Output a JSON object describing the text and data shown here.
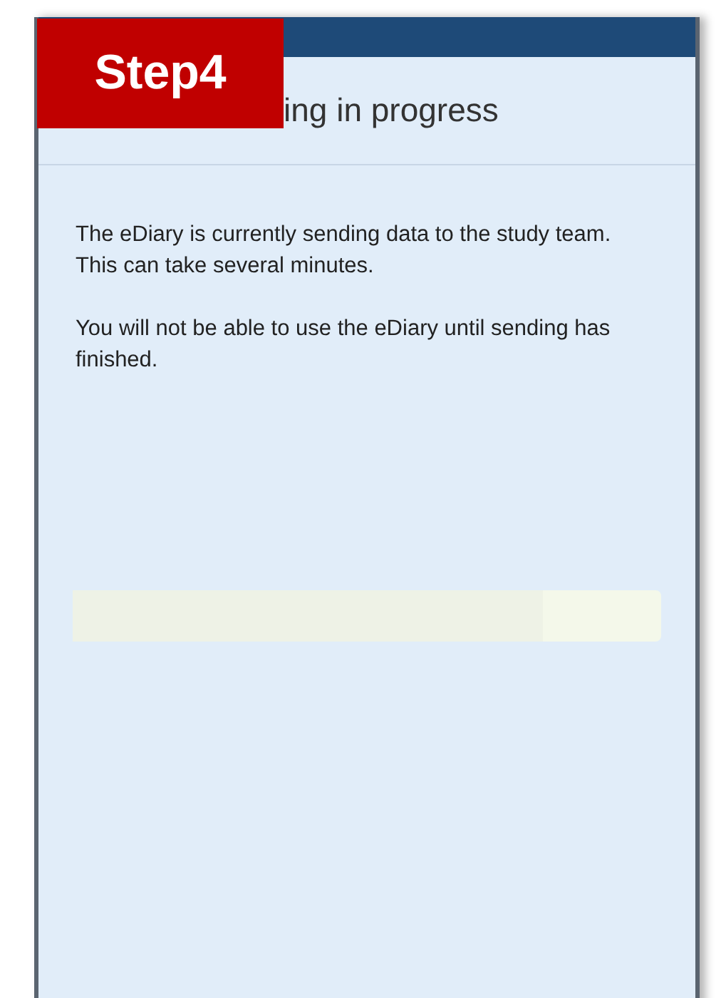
{
  "badge": {
    "label": "Step4"
  },
  "screen": {
    "title": "ing in progress",
    "paragraphs": [
      "The eDiary is currently sending data to the study team. This can take several minutes.",
      "You will not be able to use the eDiary until sending has finished."
    ],
    "progress": {
      "level": 0.8
    }
  }
}
